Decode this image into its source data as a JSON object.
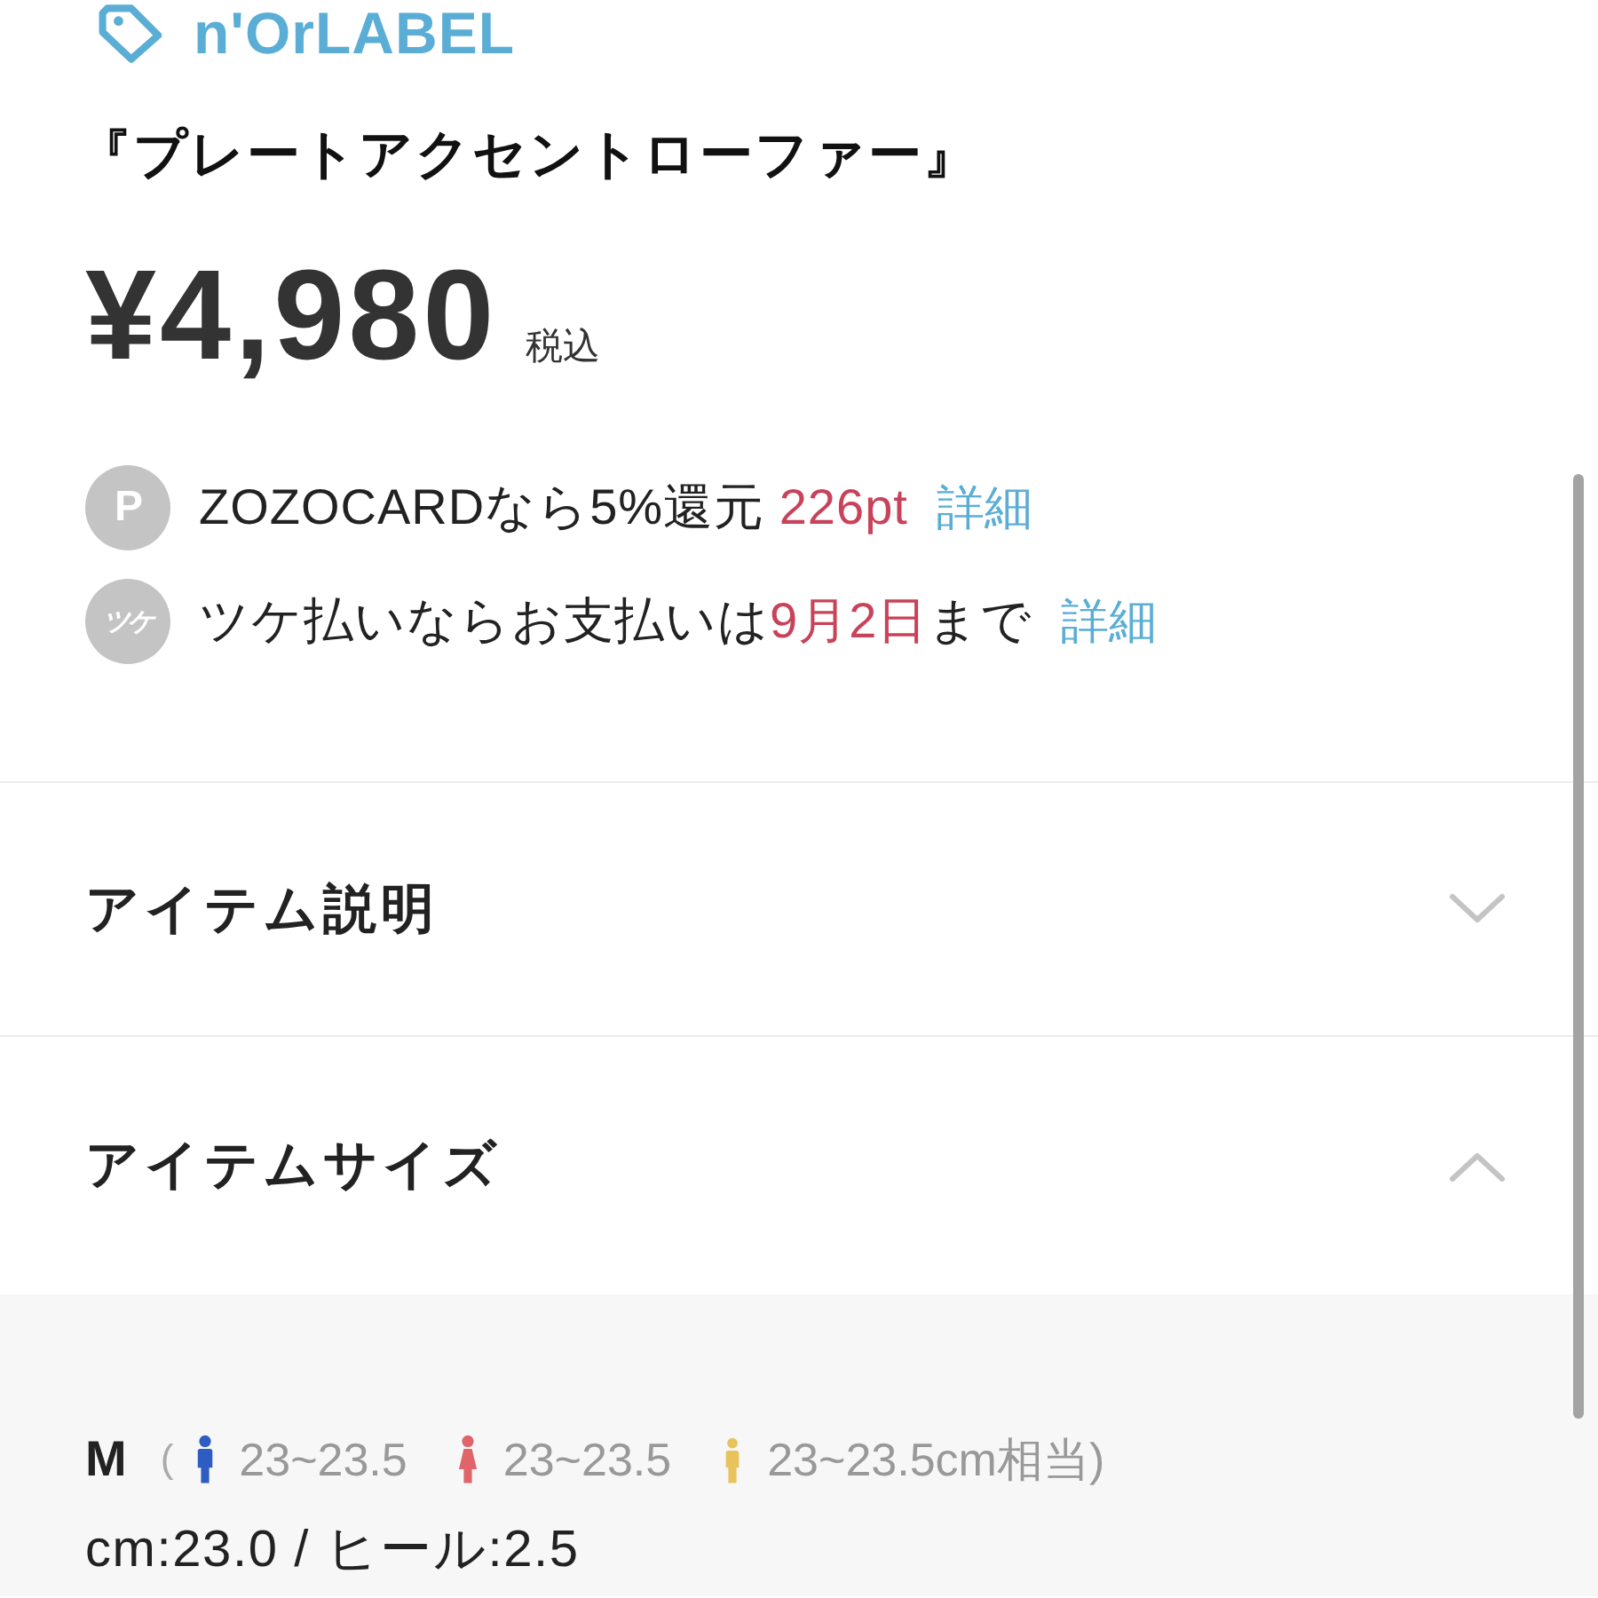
{
  "brand": {
    "name": "n'OrLABEL"
  },
  "product": {
    "title": "『プレートアクセントローファー』",
    "price": "¥4,980",
    "tax_note": "税込"
  },
  "offers": [
    {
      "kind": "points",
      "badge": "P",
      "parts": [
        {
          "text": "ZOZOCARDなら5%還元 ",
          "emphasis": false
        },
        {
          "text": "226pt",
          "emphasis": true
        }
      ],
      "link": "詳細"
    },
    {
      "kind": "pay_later",
      "badge": "ツケ",
      "parts": [
        {
          "text": "ツケ払いならお支払いは",
          "emphasis": false
        },
        {
          "text": "9月2日",
          "emphasis": true
        },
        {
          "text": "まで",
          "emphasis": false
        }
      ],
      "link": "詳細"
    }
  ],
  "sections": [
    {
      "title": "アイテム説明",
      "expanded": false
    },
    {
      "title": "アイテムサイズ",
      "expanded": true,
      "content": {
        "size": "M",
        "open_paren": "(",
        "fits": [
          {
            "kind": "men",
            "color": "#2f5cc2",
            "range": "23~23.5"
          },
          {
            "kind": "women",
            "color": "#e0646a",
            "range": "23~23.5"
          },
          {
            "kind": "kids",
            "color": "#e8c35c",
            "range": "23~23.5cm相当)"
          }
        ],
        "measure": "cm:23.0 / ヒール:2.5"
      }
    }
  ]
}
